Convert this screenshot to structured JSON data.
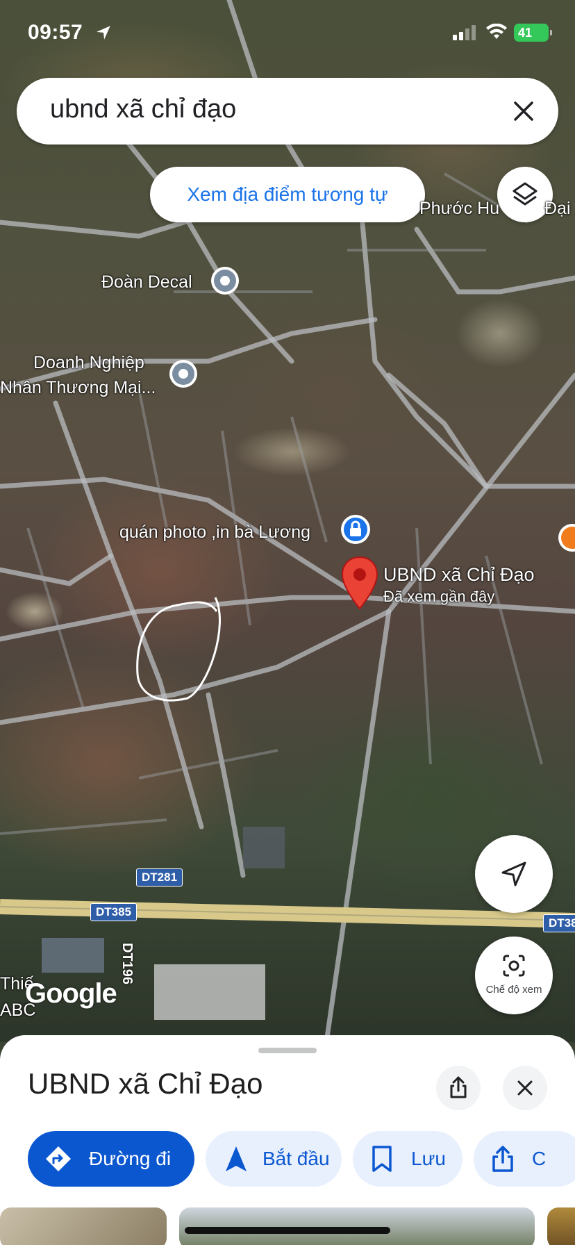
{
  "status_bar": {
    "time": "09:57",
    "battery": "41"
  },
  "search": {
    "query": "ubnd xã chỉ đạo"
  },
  "map": {
    "similar_button": "Xem địa điểm tương tự",
    "labels": {
      "phuoc": "Phước Hu",
      "dai": "Đại",
      "doan_decal": "Đoàn Decal",
      "doanh_nghiep_1": "Doanh Nghiệp",
      "doanh_nghiep_2": "Nhân Thương Mại...",
      "photo_shop": "quán photo ,in bà Lương",
      "ubnd": "UBND xã Chỉ Đạo",
      "ubnd_sub": "Đã xem gần đây",
      "thie": "Thiế",
      "abc": "ABC"
    },
    "road_shields": {
      "dt281": "DT281",
      "dt385": "DT385",
      "dt385_right": "DT38",
      "dt196": "DT196"
    },
    "google_logo": "Google",
    "view_mode_label": "Chế độ xem"
  },
  "sheet": {
    "title": "UBND xã Chỉ Đạo",
    "chips": {
      "directions": "Đường đi",
      "start": "Bắt đầu",
      "save": "Lưu",
      "share": "C"
    }
  },
  "colors": {
    "accent": "#0b57d0",
    "link": "#1a73e8",
    "pin_red": "#ea4335",
    "pin_blue": "#1a73e8"
  }
}
